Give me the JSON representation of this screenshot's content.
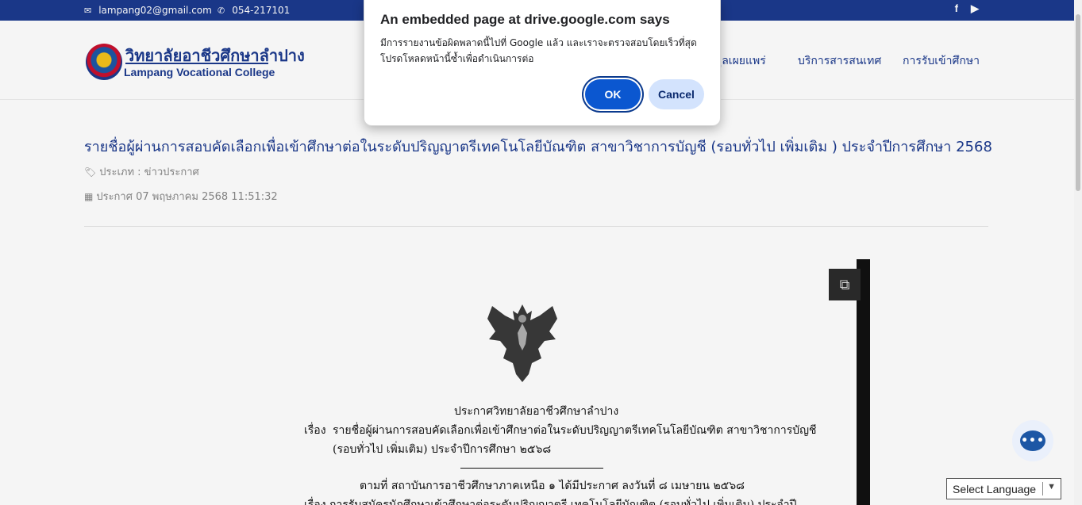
{
  "topbar": {
    "email": "lampang02@gmail.com",
    "phone": "054-217101",
    "social": [
      "facebook-icon",
      "youtube-icon"
    ]
  },
  "header": {
    "logo_th": "วิทยาลัยอาชีวศึกษาลำปาง",
    "logo_en": "Lampang Vocational College",
    "nav": [
      "มูลเผยแพร่",
      "บริการสารสนเทศ",
      "การรับเข้าศึกษา"
    ]
  },
  "article": {
    "title": "รายชื่อผู้ผ่านการสอบคัดเลือกเพื่อเข้าศึกษาต่อในระดับปริญญาตรีเทคโนโลยีบัณฑิต สาขาวิชาการบัญชี (รอบทั่วไป เพิ่มเติม ) ประจำปีการศึกษา 2568",
    "category": "ประเภท : ข่าวประกาศ",
    "date": "ประกาศ 07 พฤษภาคม 2568 11:51:32"
  },
  "document": {
    "heading": "ประกาศวิทยาลัยอาชีวศึกษาลำปาง",
    "subject_label": "เรื่อง",
    "subject_line1": "รายชื่อผู้ผ่านการสอบคัดเลือกเพื่อเข้าศึกษาต่อในระดับปริญญาตรีเทคโนโลยีบัณฑิต สาขาวิชาการบัญชี",
    "subject_line2": "(รอบทั่วไป เพิ่มเติม) ประจำปีการศึกษา ๒๕๖๘",
    "body_line1": "ตามที่ สถาบันการอาชีวศึกษาภาคเหนือ ๑ ได้มีประกาศ ลงวันที่ ๘ เมษายน ๒๕๖๘",
    "body_line2": "เรื่อง การรับสมัครนักศึกษาเข้าศึกษาต่อระดับปริญญาตรี เทคโนโลยีบัณฑิต (รอบทั่วไป เพิ่มเติม) ประจำปี"
  },
  "dialog": {
    "title": "An embedded page at drive.google.com says",
    "message": "มีการรายงานข้อผิดพลาดนี้ไปที่ Google แล้ว และเราจะตรวจสอบโดยเร็วที่สุด โปรดโหลดหน้านี้ซ้ำเพื่อดำเนินการต่อ",
    "ok_label": "OK",
    "cancel_label": "Cancel"
  },
  "language_select": {
    "label": "Select Language"
  },
  "colors": {
    "brand": "#1c3a8e",
    "dialog_ok": "#0b57d0",
    "dialog_cancel": "#d3e3fd"
  }
}
